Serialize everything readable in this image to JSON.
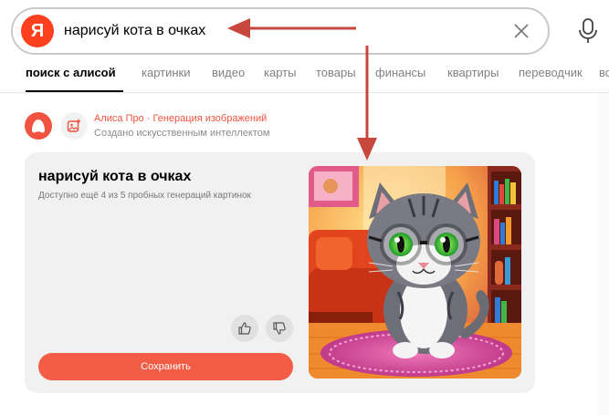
{
  "search": {
    "logo_letter": "Я",
    "query": "нарисуй кота в очках"
  },
  "icons": {
    "clear": "close-icon",
    "microphone": "microphone-icon",
    "alisa": "alisa-logo-icon",
    "image_generation": "image-generation-icon",
    "like": "thumbs-up-icon",
    "dislike": "thumbs-down-icon"
  },
  "tabs": [
    {
      "label": "поиск с алисой",
      "active": true
    },
    {
      "label": "картинки"
    },
    {
      "label": "видео"
    },
    {
      "label": "карты"
    },
    {
      "label": "товары"
    },
    {
      "label": "финансы"
    },
    {
      "label": "квартиры"
    },
    {
      "label": "переводчик"
    },
    {
      "label": "все"
    }
  ],
  "alisa": {
    "title": "Алиса Про · Генерация изображений",
    "subtitle": "Создано искусственным интеллектом"
  },
  "result": {
    "title": "нарисуй кота в очках",
    "subtitle": "Доступно ещё 4 из 5 пробных генераций картинок",
    "save_label": "Сохранить",
    "image_subject": "cat-with-glasses"
  },
  "colors": {
    "brand_red": "#fc3f1d",
    "accent_coral": "#f35d46",
    "alisa_link": "#f0533f",
    "annotation_arrow": "#c8473d",
    "card_bg": "#f1f1f1"
  }
}
